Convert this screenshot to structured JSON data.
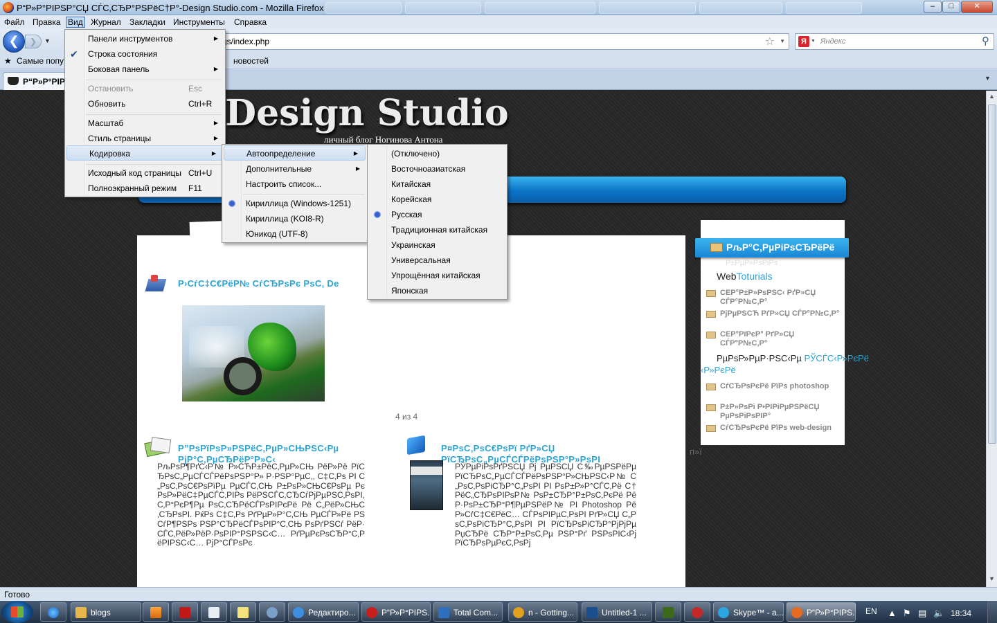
{
  "window": {
    "title": "Р“Р»Р°РІРЅР°СЏ СЃС‚СЂР°РЅРёС†Р°-Design Studio.com - Mozilla Firefox",
    "controls": [
      "–",
      "□",
      "✕"
    ]
  },
  "menubar": {
    "items": [
      "Файл",
      "Правка",
      "Вид",
      "Журнал",
      "Закладки",
      "Инструменты",
      "Справка"
    ]
  },
  "navbar": {
    "back_glyph": "❮",
    "forward_glyph": "❯",
    "url": "gs/index.php",
    "search_placeholder": "Яндекс",
    "search_engine_glyph": "Я"
  },
  "bookmarks": {
    "items": [
      "Самые попу",
      "...",
      "новостей"
    ]
  },
  "tabs": [
    {
      "label": "Р“Р»Р°РІРЅ"
    }
  ],
  "view_menu": {
    "items": [
      {
        "label": "Панели инструментов",
        "accel": "",
        "submenu": true
      },
      {
        "label": "Строка состояния",
        "accel": "",
        "checked": true
      },
      {
        "label": "Боковая панель",
        "accel": "",
        "submenu": true
      },
      {
        "label": "Остановить",
        "accel": "Esc",
        "disabled": true
      },
      {
        "label": "Обновить",
        "accel": "Ctrl+R"
      },
      {
        "label": "Масштаб",
        "accel": "",
        "submenu": true
      },
      {
        "label": "Стиль страницы",
        "accel": "",
        "submenu": true
      },
      {
        "label": "Кодировка",
        "accel": "",
        "submenu": true,
        "highlighted": true
      },
      {
        "label": "Исходный код страницы",
        "accel": "Ctrl+U"
      },
      {
        "label": "Полноэкранный режим",
        "accel": "F11"
      }
    ]
  },
  "encoding_menu": {
    "items": [
      {
        "label": "Автоопределение",
        "submenu": true,
        "highlighted": true
      },
      {
        "label": "Дополнительные",
        "submenu": true
      },
      {
        "label": "Настроить список..."
      },
      {
        "label": "Кириллица (Windows-1251)",
        "selected": true
      },
      {
        "label": "Кириллица (KOI8-R)"
      },
      {
        "label": "Юникод (UTF-8)"
      }
    ]
  },
  "autodetect_menu": {
    "items": [
      {
        "label": "(Отключено)"
      },
      {
        "label": "Восточноазиатская"
      },
      {
        "label": "Китайская"
      },
      {
        "label": "Корейская"
      },
      {
        "label": "Русская",
        "selected": true
      },
      {
        "label": "Традиционная китайская"
      },
      {
        "label": "Украинская"
      },
      {
        "label": "Универсальная"
      },
      {
        "label": "Упрощённая китайская"
      },
      {
        "label": "Японская"
      }
    ]
  },
  "page": {
    "site_title": "Design Studio",
    "site_subtitle": "личный блог Ногинова Антона",
    "post1_title": "Р›СѓС‡С€РёР№ СѓСЂРѕРє РѕС‚ De",
    "pager": "4 из 4",
    "post2_title_l1": "Р”РѕРїРѕР»РЅРёС‚РµР»СЊРЅС‹Рµ",
    "post2_title_l2": "РјР°С‚РµСЂРёР°Р»С‹",
    "post2_body": "РљРѕР¶РґС‹Р№ Р»СЋР±РёС‚РµР»СЊ РёР»Рё РїСЂРѕС„РµСЃСЃРёРѕРЅР°Р» Р·РЅР°РµС‚, С‡С‚Рѕ РІ С„РѕС‚РѕС€РѕРїРµ РµСЃС‚СЊ Р±РѕР»СЊС€РѕРµ РєРѕР»РёС‡РµСЃС‚РІРѕ РёРЅСЃС‚СЂСѓРјРµРЅС‚РѕРІ, С‚Р°РєР¶Рµ РѕС‚СЂРёСЃРѕРІРєРё Рё С„РёР»СЊС‚СЂРѕРІ. РќРѕ С‡С‚Рѕ РґРµР»Р°С‚СЊ РµСЃР»Рё РЅСѓР¶РЅРѕ РЅР°СЂРёСЃРѕРІР°С‚СЊ РѕРґРЅСѓ РёР· СЃС‚РёР»РёР·РѕРІР°РЅРЅС‹С… РґРµРєРѕСЂР°С‚РёРІРЅС‹С… РјР°СЃРѕРє",
    "post3_title_l1": "Р¤РѕС‚РѕС€РѕРї                    РґР»СЏ",
    "post3_title_l2": "РїСЂРѕС„РµСЃСЃРёРѕРЅР°Р»РѕРІ",
    "post3_body": "РЎРµРіРѕРґРЅСЏ Рј РµРЅСЏ С‰РµРЅРёРµ РїСЂРѕС„РµСЃСЃРёРѕРЅР°Р»СЊРЅС‹Р№ С„РѕС‚РѕРіСЂР°С„РѕРІ РІ РѕР±Р»Р°СЃС‚Рё С†РёС„СЂРѕРІРѕР№ РѕР±СЂР°Р±РѕС‚РєРё РёР·РѕР±СЂР°Р¶РµРЅРёР№ РІ Photoshop Рё Р»СѓС‡С€РёС… СЃРѕРІРµС‚РѕРІ РґР»СЏ С„РѕС‚РѕРіСЂР°С„РѕРІ РІ РїСЂРѕРіСЂР°РјРјРµ РџСЂРё СЂР°Р±РѕС‚Рµ РЅР°Рґ РЅРѕРІС‹Рј РїСЂРѕРµРєС‚РѕРј"
  },
  "sidebar": {
    "ribbon_title": "РљР°С‚РµРіРѕСЂРёРё",
    "ribbon_sub": "Р±РµР»РѕРіРѕ",
    "webtut_a": "Web",
    "webtut_b": "Toturials",
    "cats": [
      "СЕР°Р±Р»РѕРЅС‹ РґР»СЏ СЃР°Р№С‚Р°",
      "РјРµРЅСЋ РґР»СЏ СЃР°Р№С‚Р°",
      "СЕР°РїРєР° РґР»СЏ СЃР°Р№С‚Р°"
    ],
    "tag_a": "РµРѕР»РµР·РЅС‹Рµ ",
    "tag_b": "РЎСЃС‹Р»РєРё",
    "cats2": [
      "СѓСЂРѕРєРё РїРѕ photoshop",
      "Р±Р»РѕРі Р•РІРіРµРЅРёСЏ РµРѕРіРѕРІР°",
      "СѓСЂРѕРєРё РїРѕ web-design"
    ],
    "hint": "п»ї"
  },
  "status": {
    "text": "Готово"
  },
  "taskbar": {
    "tasks": [
      {
        "label": "blogs",
        "icon_color": "#e8b64a"
      },
      {
        "label": "Редактиро...",
        "icon_color": "#3f8fe0"
      },
      {
        "label": "Р“Р»Р°РІРЅ...",
        "icon_color": "#cc1d1d"
      },
      {
        "label": "Total Com...",
        "icon_color": "#2f6fbf"
      },
      {
        "label": "n - Gotting...",
        "icon_color": "#e0a020"
      },
      {
        "label": "Untitled-1 ...",
        "icon_color": "#1a4e8f"
      },
      {
        "label": "Skype™ - a...",
        "icon_color": "#2ba6e1"
      },
      {
        "label": "Р“Р»Р°РІРЅ...",
        "icon_color": "#e86a1e"
      }
    ],
    "lang": "EN",
    "clock": "18:34"
  }
}
